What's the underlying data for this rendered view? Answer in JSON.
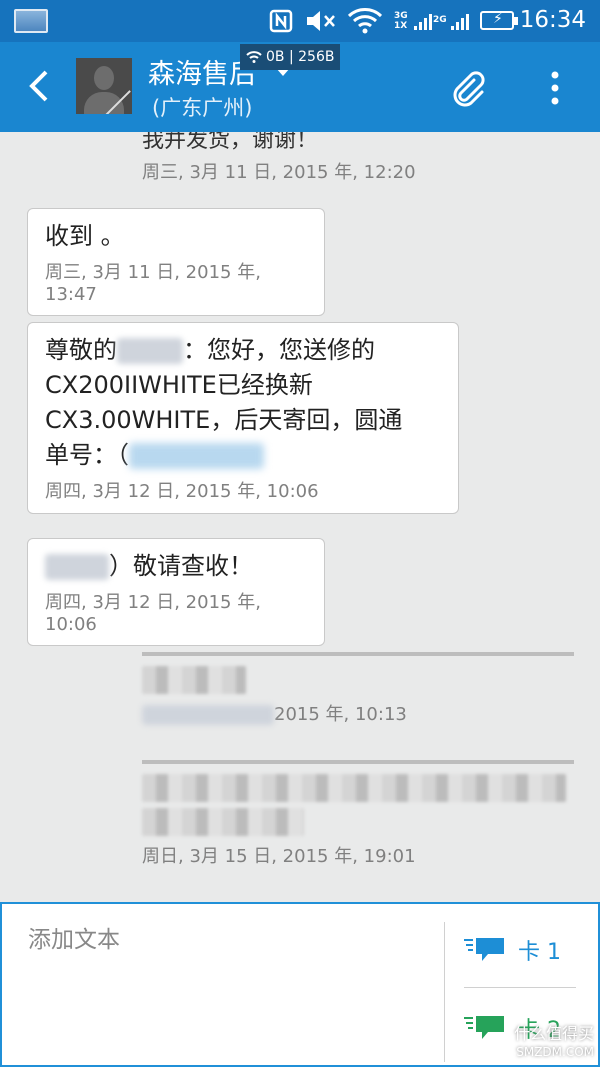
{
  "status_bar": {
    "net1": "3G",
    "net1b": "1X",
    "net2": "2G",
    "time": "16:34",
    "traffic": "0B | 256B"
  },
  "contact": {
    "name": "森海售后",
    "location": "(广东广州)"
  },
  "messages": [
    {
      "id": "m0",
      "text": "我并发货，谢谢！",
      "time": "周三, 3月 11 日, 2015 年, 12:20"
    },
    {
      "id": "m1",
      "text": "收到 。",
      "time": "周三, 3月 11 日, 2015 年, 13:47"
    },
    {
      "id": "m2",
      "lines": [
        "尊敬的",
        "：您好，您送修的",
        "CX200IIWHITE已经换新",
        "CX3.00WHITE，后天寄回，圆通",
        "单号：（"
      ],
      "time": "周四, 3月 12 日, 2015 年, 10:06"
    },
    {
      "id": "m3",
      "text": "）敬请查收！",
      "time": "周四, 3月 12 日, 2015 年, 10:06"
    },
    {
      "id": "m4",
      "time": "2015 年, 10:13"
    },
    {
      "id": "m5",
      "time": "周日, 3月 15 日, 2015 年, 19:01"
    }
  ],
  "compose": {
    "placeholder": "添加文本",
    "sim1": "卡 1",
    "sim2": "卡 2"
  },
  "watermark": {
    "line1": "什么值得买",
    "line2": "SMZDM.COM"
  },
  "icons": {
    "back": "chevron-left-icon",
    "attach": "paperclip-icon",
    "more": "overflow-menu-icon",
    "nfc": "nfc-icon",
    "mute": "mute-icon",
    "wifi": "wifi-icon",
    "battery": "battery-charging-icon",
    "sim_send": "send-message-icon"
  },
  "colors": {
    "status_bar": "#1673bd",
    "app_bar": "#1a86d0",
    "sim1": "#1d8ed6",
    "sim2": "#26a35a"
  }
}
